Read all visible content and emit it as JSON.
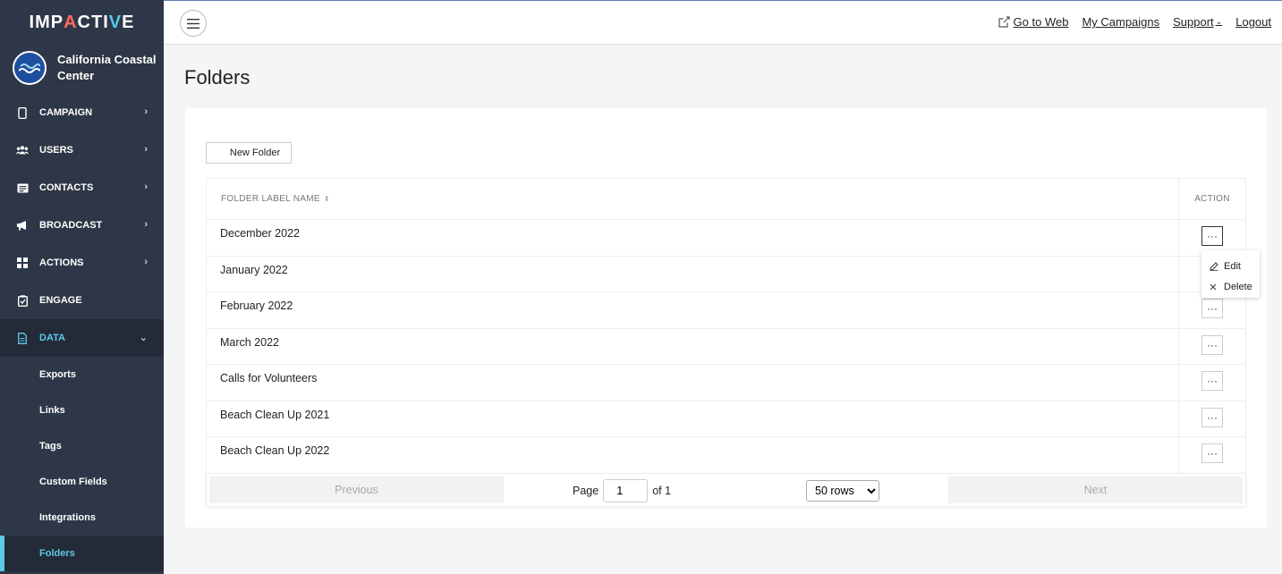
{
  "brand": {
    "logo_pre": "IMP",
    "logo_a": "A",
    "logo_c": "C",
    "logo_ti": "TI",
    "logo_v": "V",
    "logo_e": "E"
  },
  "org": {
    "name_line1": "California Coastal",
    "name_line2": "Center"
  },
  "nav": [
    {
      "label": "CAMPAIGN",
      "icon": "phone-icon"
    },
    {
      "label": "USERS",
      "icon": "users-icon"
    },
    {
      "label": "CONTACTS",
      "icon": "contacts-icon"
    },
    {
      "label": "BROADCAST",
      "icon": "megaphone-icon"
    },
    {
      "label": "ACTIONS",
      "icon": "grid-icon"
    },
    {
      "label": "ENGAGE",
      "icon": "clipboard-icon"
    },
    {
      "label": "DATA",
      "icon": "document-icon"
    }
  ],
  "subnav": [
    "Exports",
    "Links",
    "Tags",
    "Custom Fields",
    "Integrations",
    "Folders"
  ],
  "header": {
    "go_to_web": "Go to Web",
    "my_campaigns": "My Campaigns",
    "support": "Support",
    "logout": "Logout"
  },
  "page": {
    "title": "Folders",
    "new_folder": "New Folder"
  },
  "table": {
    "col_name": "FOLDER LABEL NAME",
    "col_action": "ACTION",
    "rows": [
      "December 2022",
      "January 2022",
      "February 2022",
      "March 2022",
      "Calls for Volunteers",
      "Beach Clean Up 2021",
      "Beach Clean Up 2022"
    ],
    "action_glyph": "···"
  },
  "menu": {
    "edit": "Edit",
    "delete": "Delete"
  },
  "pagination": {
    "previous": "Previous",
    "page_label": "Page",
    "current_page": "1",
    "of_label": "of 1",
    "rows_option": "50 rows",
    "next": "Next"
  },
  "colors": {
    "sidebar": "#2e3747",
    "sidebar_active": "#232b39",
    "accent": "#5ec8e5",
    "logo_red": "#ff6b5a"
  }
}
